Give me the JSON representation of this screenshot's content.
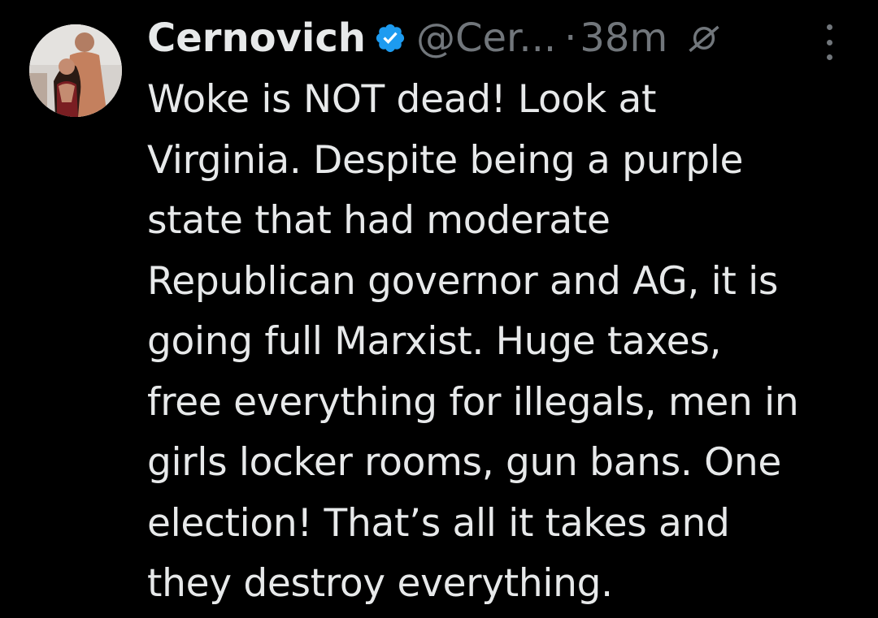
{
  "tweet": {
    "display_name": "Cernovich",
    "handle": "@Cer...",
    "separator": "·",
    "time": "38m",
    "lines": [
      "Woke is NOT dead! Look at",
      "Virginia. Despite being a purple",
      "state that had moderate",
      "Republican governor and AG, it is",
      "going full Marxist. Huge taxes,",
      "free everything for illegals, men in",
      "girls locker rooms, gun bans. One",
      "election! That’s all it takes and",
      "they destroy everything."
    ]
  },
  "icons": {
    "verified": "verified-badge-icon",
    "mute": "muted-icon",
    "more": "more-options-icon"
  },
  "colors": {
    "background": "#000000",
    "text": "#e7e9ea",
    "secondary": "#71767b",
    "verified_blue": "#1d9bf0"
  }
}
